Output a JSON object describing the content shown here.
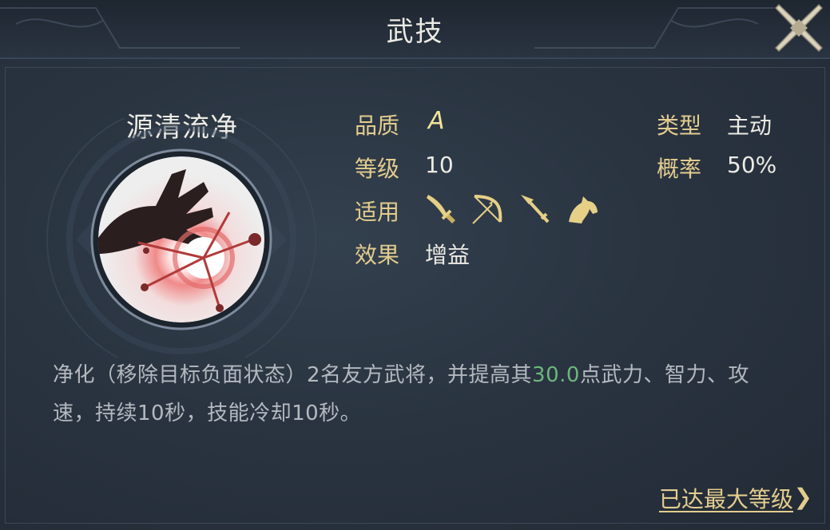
{
  "header": {
    "title": "武技"
  },
  "skill": {
    "name": "源清流净",
    "attributes": {
      "quality_label": "品质",
      "quality_value": "A",
      "level_label": "等级",
      "level_value": "10",
      "applicable_label": "适用",
      "effect_label": "效果",
      "effect_value": "增益",
      "type_label": "类型",
      "type_value": "主动",
      "probability_label": "概率",
      "probability_value": "50%"
    },
    "applicable_icons": [
      "sword-icon",
      "bow-icon",
      "spear-icon",
      "horse-icon"
    ],
    "description": {
      "part1": "净化（移除目标负面状态）2名友方武将，并提高其",
      "highlight": "30.0",
      "part2": "点武力、智力、攻速，持续10秒，技能冷却10秒。"
    },
    "max_level_text": "已达最大等级",
    "max_level_chevron": "❯"
  },
  "colors": {
    "label_gold": "#e3cd8e",
    "highlight_green": "#6bb77b",
    "background": "#262f3b"
  }
}
